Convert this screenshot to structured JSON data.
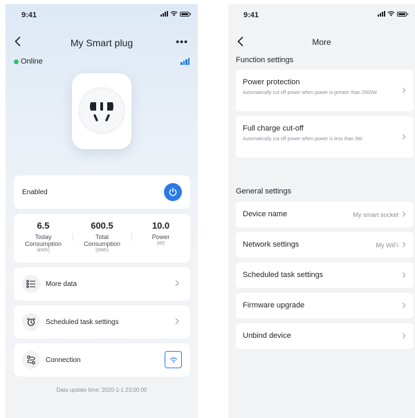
{
  "status_bar": {
    "time": "9:41"
  },
  "left": {
    "nav": {
      "title": "My Smart plug",
      "more": "•••"
    },
    "status": {
      "online_label": "Online"
    },
    "enabled_card": {
      "label": "Enabled"
    },
    "stats": [
      {
        "value": "6.5",
        "label_line1": "Today",
        "label_line2": "Consumption",
        "unit": "(kWh)"
      },
      {
        "value": "600.5",
        "label_line1": "Total",
        "label_line2": "Consumption",
        "unit": "(kWh)"
      },
      {
        "value": "10.0",
        "label_line1": "Power",
        "label_line2": "",
        "unit": "(W)"
      }
    ],
    "rows": {
      "more_data": "More data",
      "scheduled": "Scheduled task settings",
      "connection": "Connection"
    },
    "update_time": "Data update time: 2020-1-1 23:00:00"
  },
  "right": {
    "nav": {
      "title": "More"
    },
    "function_section": "Function settings",
    "power_protection": {
      "title": "Power protection",
      "desc": "Automatically cut off power when power is greater than 2500W"
    },
    "full_charge": {
      "title": "Full charge cut-off",
      "desc": "Automatically cut off power when power is less than 3W"
    },
    "general_section": "General settings",
    "device_name": {
      "title": "Device name",
      "value": "My smart socket"
    },
    "network": {
      "title": "Network settings",
      "value": "My WiFi"
    },
    "scheduled": {
      "title": "Scheduled task settings"
    },
    "firmware": {
      "title": "Firmware upgrade"
    },
    "unbind": {
      "title": "Unbind device"
    }
  },
  "colors": {
    "accent": "#2c7be5",
    "online": "#33c26b",
    "background": "#f2f3f5"
  },
  "icons": {
    "power": "power-icon",
    "more_data": "list-icon",
    "scheduled": "alarm-clock-icon",
    "connection": "connection-icon",
    "wifi": "wifi-icon"
  }
}
